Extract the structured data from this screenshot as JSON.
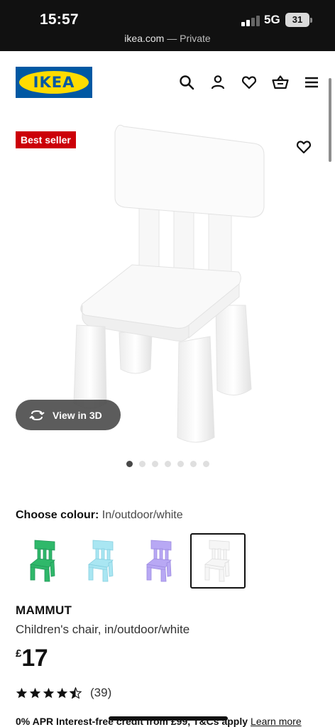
{
  "status_bar": {
    "time": "15:57",
    "network": "5G",
    "battery": "31",
    "host": "ikea.com",
    "private_label": " — Private"
  },
  "header": {
    "logo_text": "IKEA",
    "icons": [
      "search-icon",
      "account-icon",
      "heart-icon",
      "basket-icon",
      "menu-icon"
    ]
  },
  "product_media": {
    "badge": "Best seller",
    "view_3d_label": "View in 3D",
    "image_count": 7,
    "active_image": 1
  },
  "colour": {
    "label": "Choose colour:",
    "selected": "In/outdoor/white",
    "options": [
      {
        "name": "green",
        "hex": "#2fb86a"
      },
      {
        "name": "light blue",
        "hex": "#a9e6f2"
      },
      {
        "name": "lilac",
        "hex": "#b8a8f4"
      },
      {
        "name": "white",
        "hex": "#f6f6f6"
      }
    ],
    "selected_index": 3
  },
  "product": {
    "name": "MAMMUT",
    "description": "Children's chair, in/outdoor/white",
    "currency": "£",
    "price": "17",
    "rating_stars": 4.5,
    "reviews": "(39)"
  },
  "credit": {
    "text": "0% APR Interest-free credit from £99, T&Cs apply",
    "link": "Learn more"
  },
  "colors": {
    "brand_blue": "#0058a3",
    "brand_yellow": "#ffdb00",
    "badge_red": "#cc0008"
  }
}
